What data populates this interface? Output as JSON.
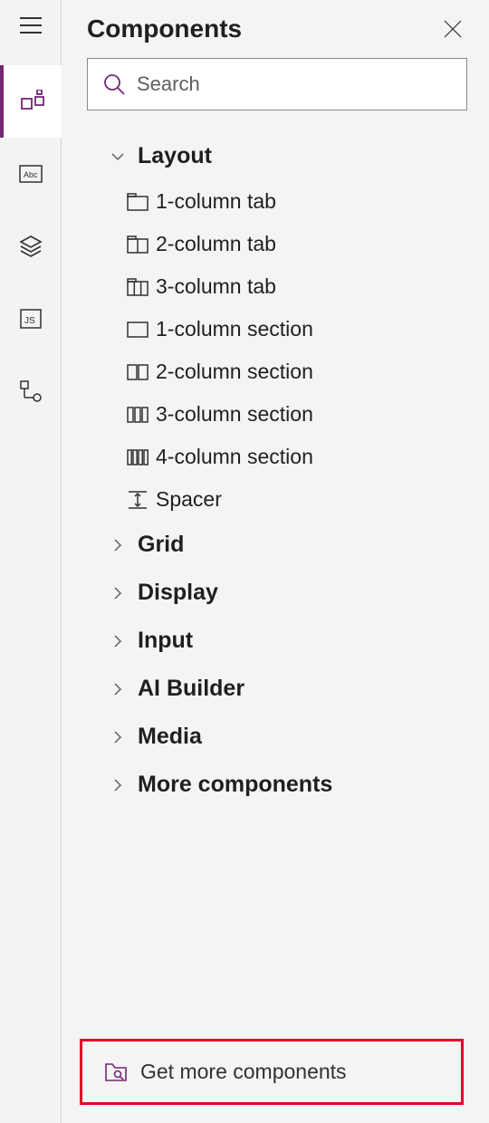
{
  "panel": {
    "title": "Components",
    "search_placeholder": "Search",
    "footer_label": "Get more components"
  },
  "sidebar": {
    "items": [
      {
        "name": "hamburger"
      },
      {
        "name": "components",
        "selected": true
      },
      {
        "name": "form-fields"
      },
      {
        "name": "layers"
      },
      {
        "name": "javascript"
      },
      {
        "name": "tree-view"
      }
    ]
  },
  "groups": [
    {
      "label": "Layout",
      "expanded": true,
      "items": [
        {
          "label": "1-column tab",
          "icon": "tab1"
        },
        {
          "label": "2-column tab",
          "icon": "tab2"
        },
        {
          "label": "3-column tab",
          "icon": "tab3"
        },
        {
          "label": "1-column section",
          "icon": "sec1"
        },
        {
          "label": "2-column section",
          "icon": "sec2"
        },
        {
          "label": "3-column section",
          "icon": "sec3"
        },
        {
          "label": "4-column section",
          "icon": "sec4"
        },
        {
          "label": "Spacer",
          "icon": "spacer"
        }
      ]
    },
    {
      "label": "Grid",
      "expanded": false
    },
    {
      "label": "Display",
      "expanded": false
    },
    {
      "label": "Input",
      "expanded": false
    },
    {
      "label": "AI Builder",
      "expanded": false
    },
    {
      "label": "Media",
      "expanded": false
    },
    {
      "label": "More components",
      "expanded": false
    }
  ]
}
